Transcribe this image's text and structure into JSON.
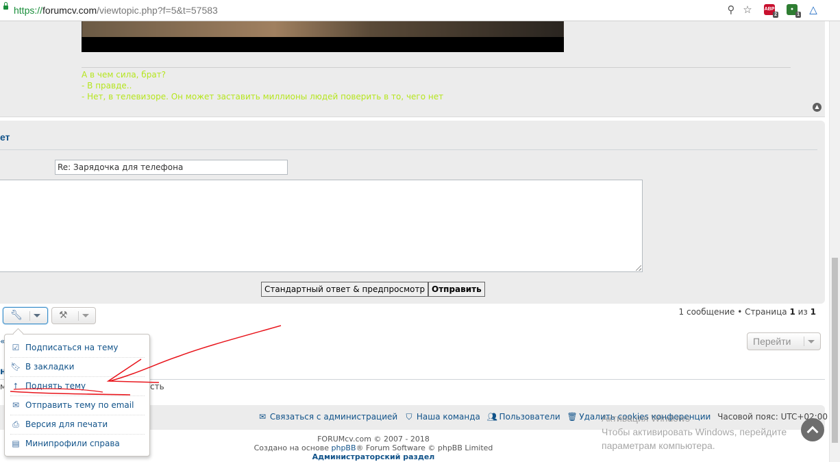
{
  "browser": {
    "url_scheme": "https://",
    "url_host": "forumcv.com",
    "url_path": "/viewtopic.php?f=5&t=57583",
    "abp_count": "2",
    "ext_count": "1"
  },
  "post": {
    "signature_lines": [
      "А в чем сила, брат?",
      "- В правде..",
      "- Нет, в телевизоре. Он может заставить миллионы людей поверить в то, чего нет"
    ],
    "signature_color": "#b5e61d"
  },
  "quick_reply": {
    "title": "ет",
    "subject_value": "Re: Зарядочка для телефона",
    "preview_label": "Стандартный ответ & предпросмотр",
    "submit_label": "Отправить"
  },
  "pagination": {
    "count_text": "1 сообщение",
    "page_word": "Страница",
    "current_page": "1",
    "of_word": "из",
    "total_pages": "1"
  },
  "jumpbox": {
    "label": "Перейти"
  },
  "stubs": {
    "left_k": "«",
    "left_h": "н",
    "left_m": "м",
    "partial": "сть"
  },
  "dropdown": {
    "items": [
      {
        "label": "Подписаться на тему",
        "icon": "check-square-icon"
      },
      {
        "label": "В закладки",
        "icon": "bookmark-icon"
      },
      {
        "label": "Поднять тему",
        "icon": "arrow-up-icon"
      },
      {
        "label": "Отправить тему по email",
        "icon": "envelope-icon"
      },
      {
        "label": "Версия для печати",
        "icon": "print-icon"
      },
      {
        "label": "Минипрофили справа",
        "icon": "profile-card-icon"
      }
    ]
  },
  "footer": {
    "contact": "Связаться с администрацией",
    "team": "Наша команда",
    "members": "Пользователи",
    "delete_cookies": "Удалить cookies конференции",
    "timezone": "Часовой пояс: UTC+02:00",
    "copyright_line1": "FORUMcv.com © 2007 - 2018",
    "powered_prefix": "Создано на основе ",
    "phpbb": "phpBB",
    "powered_suffix": "® Forum Software © phpBB Limited",
    "admin": "Администраторский раздел"
  },
  "watermark": {
    "line1": "Активация Windows",
    "line2": "Чтобы активировать Windows, перейдите",
    "line3": "параметрам компьютера."
  },
  "annotation_color": "#e8141b"
}
